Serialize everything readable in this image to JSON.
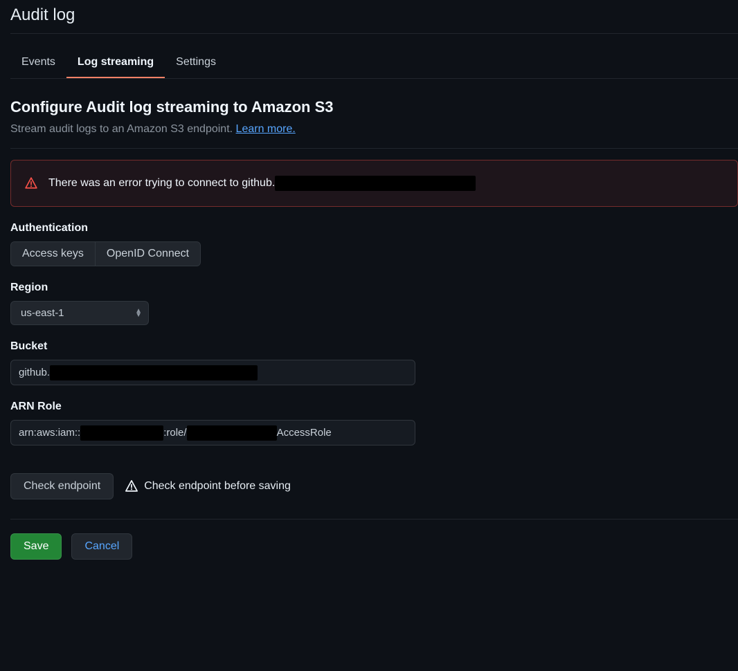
{
  "header": {
    "title": "Audit log"
  },
  "tabs": [
    {
      "label": "Events",
      "active": false
    },
    {
      "label": "Log streaming",
      "active": true
    },
    {
      "label": "Settings",
      "active": false
    }
  ],
  "config": {
    "title": "Configure Audit log streaming to Amazon S3",
    "description": "Stream audit logs to an Amazon S3 endpoint.",
    "learn_more": "Learn more."
  },
  "alert": {
    "message_prefix": "There was an error trying to connect to github."
  },
  "form": {
    "authentication": {
      "label": "Authentication",
      "options": [
        "Access keys",
        "OpenID Connect"
      ]
    },
    "region": {
      "label": "Region",
      "value": "us-east-1"
    },
    "bucket": {
      "label": "Bucket",
      "prefix": "github."
    },
    "arn_role": {
      "label": "ARN Role",
      "part1": "arn:aws:iam::",
      "part2": ":role/",
      "part3": "AccessRole"
    }
  },
  "actions": {
    "check_endpoint": "Check endpoint",
    "check_hint": "Check endpoint before saving",
    "save": "Save",
    "cancel": "Cancel"
  }
}
